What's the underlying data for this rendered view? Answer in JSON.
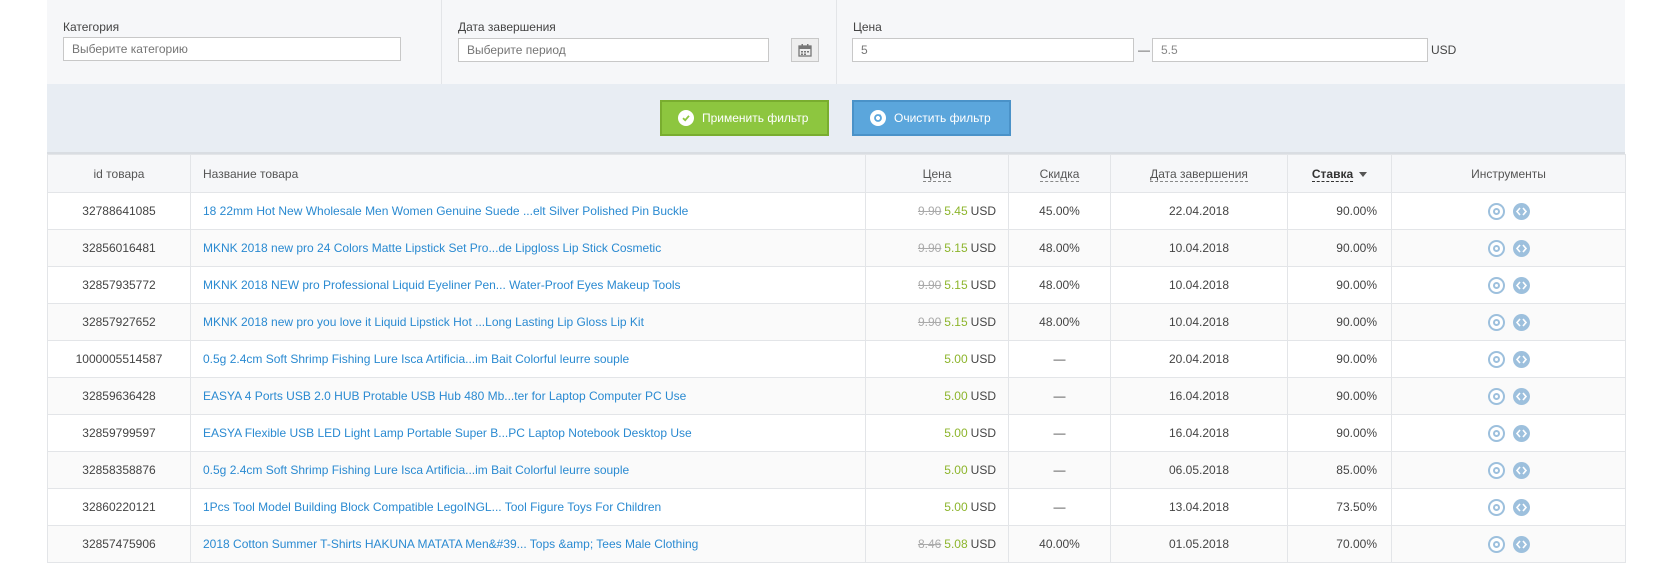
{
  "filters": {
    "category": {
      "label": "Категория",
      "placeholder": "Выберите категорию"
    },
    "end_date": {
      "label": "Дата завершения",
      "placeholder": "Выберите период"
    },
    "price": {
      "label": "Цена",
      "from": "5",
      "to": "5.5",
      "dash": "—",
      "currency": "USD"
    }
  },
  "buttons": {
    "apply": "Применить фильтр",
    "clear": "Очистить фильтр"
  },
  "table": {
    "headers": {
      "id": "id товара",
      "name": "Название товара",
      "price": "Цена",
      "discount": "Скидка",
      "end_date": "Дата завершения",
      "rate": "Ставка",
      "tools": "Инструменты"
    },
    "rows": [
      {
        "id": "32788641085",
        "name": "18 22mm Hot New Wholesale Men Women Genuine Suede ...elt Silver Polished Pin Buckle",
        "old_price": "9.90",
        "price": "5.45",
        "currency": "USD",
        "discount": "45.00%",
        "date": "22.04.2018",
        "rate": "90.00%"
      },
      {
        "id": "32856016481",
        "name": "MKNK 2018 new pro 24 Colors Matte Lipstick Set Pro...de Lipgloss Lip Stick Cosmetic",
        "old_price": "9.90",
        "price": "5.15",
        "currency": "USD",
        "discount": "48.00%",
        "date": "10.04.2018",
        "rate": "90.00%"
      },
      {
        "id": "32857935772",
        "name": "MKNK 2018 NEW pro Professional Liquid Eyeliner Pen... Water-Proof Eyes Makeup Tools",
        "old_price": "9.90",
        "price": "5.15",
        "currency": "USD",
        "discount": "48.00%",
        "date": "10.04.2018",
        "rate": "90.00%"
      },
      {
        "id": "32857927652",
        "name": "MKNK 2018 new pro you love it Liquid Lipstick Hot ...Long Lasting Lip Gloss Lip Kit",
        "old_price": "9.90",
        "price": "5.15",
        "currency": "USD",
        "discount": "48.00%",
        "date": "10.04.2018",
        "rate": "90.00%"
      },
      {
        "id": "1000005514587",
        "name": "0.5g 2.4cm Soft Shrimp Fishing Lure Isca Artificia...im Bait Colorful leurre souple",
        "old_price": "",
        "price": "5.00",
        "currency": "USD",
        "discount": "—",
        "date": "20.04.2018",
        "rate": "90.00%"
      },
      {
        "id": "32859636428",
        "name": "EASYA 4 Ports USB 2.0 HUB Protable USB Hub 480 Mb...ter for Laptop Computer PC Use",
        "old_price": "",
        "price": "5.00",
        "currency": "USD",
        "discount": "—",
        "date": "16.04.2018",
        "rate": "90.00%"
      },
      {
        "id": "32859799597",
        "name": "EASYA Flexible USB LED Light Lamp Portable Super B...PC Laptop Notebook Desktop Use",
        "old_price": "",
        "price": "5.00",
        "currency": "USD",
        "discount": "—",
        "date": "16.04.2018",
        "rate": "90.00%"
      },
      {
        "id": "32858358876",
        "name": "0.5g 2.4cm Soft Shrimp Fishing Lure Isca Artificia...im Bait Colorful leurre souple",
        "old_price": "",
        "price": "5.00",
        "currency": "USD",
        "discount": "—",
        "date": "06.05.2018",
        "rate": "85.00%"
      },
      {
        "id": "32860220121",
        "name": "1Pcs Tool Model Building Block Compatible LegoINGL... Tool Figure Toys For Children",
        "old_price": "",
        "price": "5.00",
        "currency": "USD",
        "discount": "—",
        "date": "13.04.2018",
        "rate": "73.50%"
      },
      {
        "id": "32857475906",
        "name": "2018 Cotton Summer T-Shirts HAKUNA MATATA Men&#39... Tops &amp; Tees Male Clothing",
        "old_price": "8.46",
        "price": "5.08",
        "currency": "USD",
        "discount": "40.00%",
        "date": "01.05.2018",
        "rate": "70.00%"
      }
    ]
  },
  "colors": {
    "link": "#2a8ad1",
    "price_new": "#8db52c",
    "apply": "#8dc63f",
    "clear": "#5ba6dc"
  },
  "icons": {
    "apply": "check-circle-icon",
    "clear": "refresh-icon",
    "calendar": "calendar-icon",
    "tool1": "target-icon",
    "tool2": "code-icon"
  }
}
